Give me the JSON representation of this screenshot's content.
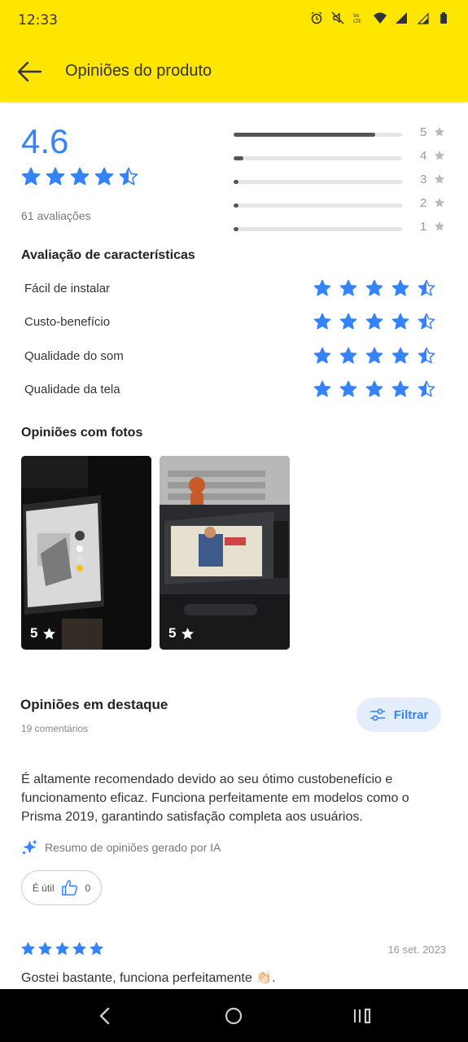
{
  "status_bar": {
    "time": "12:33",
    "icons": [
      "alarm-icon",
      "mute-icon",
      "volte-icon",
      "wifi-icon",
      "signal-icon",
      "signal-5g-icon",
      "battery-icon"
    ]
  },
  "app_bar": {
    "title": "Opiniões do produto",
    "back_icon": "arrow-left-icon"
  },
  "rating_summary": {
    "score": "4.6",
    "stars": 4.6,
    "count_label": "61 avaliações",
    "distribution": [
      {
        "star": "5",
        "fraction": 0.84
      },
      {
        "star": "4",
        "fraction": 0.06
      },
      {
        "star": "3",
        "fraction": 0.03
      },
      {
        "star": "2",
        "fraction": 0.03
      },
      {
        "star": "1",
        "fraction": 0.03
      }
    ]
  },
  "features": {
    "title": "Avaliação de características",
    "items": [
      {
        "label": "Fácil de instalar",
        "stars": 4.5
      },
      {
        "label": "Custo-benefício",
        "stars": 4.5
      },
      {
        "label": "Qualidade do som",
        "stars": 4.5
      },
      {
        "label": "Qualidade da tela",
        "stars": 4.5
      }
    ]
  },
  "photos": {
    "title": "Opiniões com fotos",
    "items": [
      {
        "rating": "5"
      },
      {
        "rating": "5"
      }
    ]
  },
  "highlights": {
    "title": "Opiniões em destaque",
    "comments": "19 comentários",
    "filter_label": "Filtrar",
    "summary": "É altamente recomendado devido ao seu ótimo custobenefício e funcionamento eficaz. Funciona perfeitamente em modelos como o Prisma 2019, garantindo satisfação completa aos usuários.",
    "ai_label": "Resumo de opiniões gerado por IA",
    "useful_label": "É útil",
    "useful_count": "0"
  },
  "review": {
    "stars": 5,
    "date": "16 set. 2023",
    "text": "Gostei bastante, funciona perfeitamente 👏🏻."
  },
  "colors": {
    "brand_yellow": "#ffe600",
    "accent_blue": "#3483fa",
    "bar_fill": "#555555"
  }
}
